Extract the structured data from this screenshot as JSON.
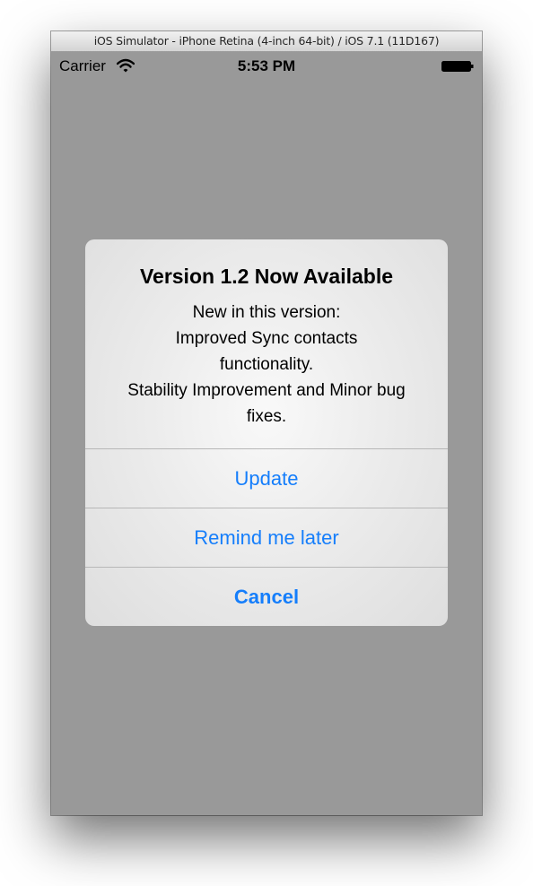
{
  "window": {
    "title": "iOS Simulator - iPhone Retina (4-inch 64-bit) / iOS 7.1 (11D167)"
  },
  "status_bar": {
    "carrier": "Carrier",
    "time": "5:53 PM",
    "icons": [
      "wifi-icon",
      "battery-icon"
    ]
  },
  "alert": {
    "title": "Version 1.2 Now Available",
    "message_lines": [
      "New in this version:",
      "Improved Sync contacts",
      "functionality.",
      "Stability Improvement and Minor bug",
      "fixes."
    ],
    "buttons": {
      "update": "Update",
      "remind": "Remind me later",
      "cancel": "Cancel"
    }
  },
  "colors": {
    "accent": "#157efb",
    "dim_background": "#999999"
  }
}
